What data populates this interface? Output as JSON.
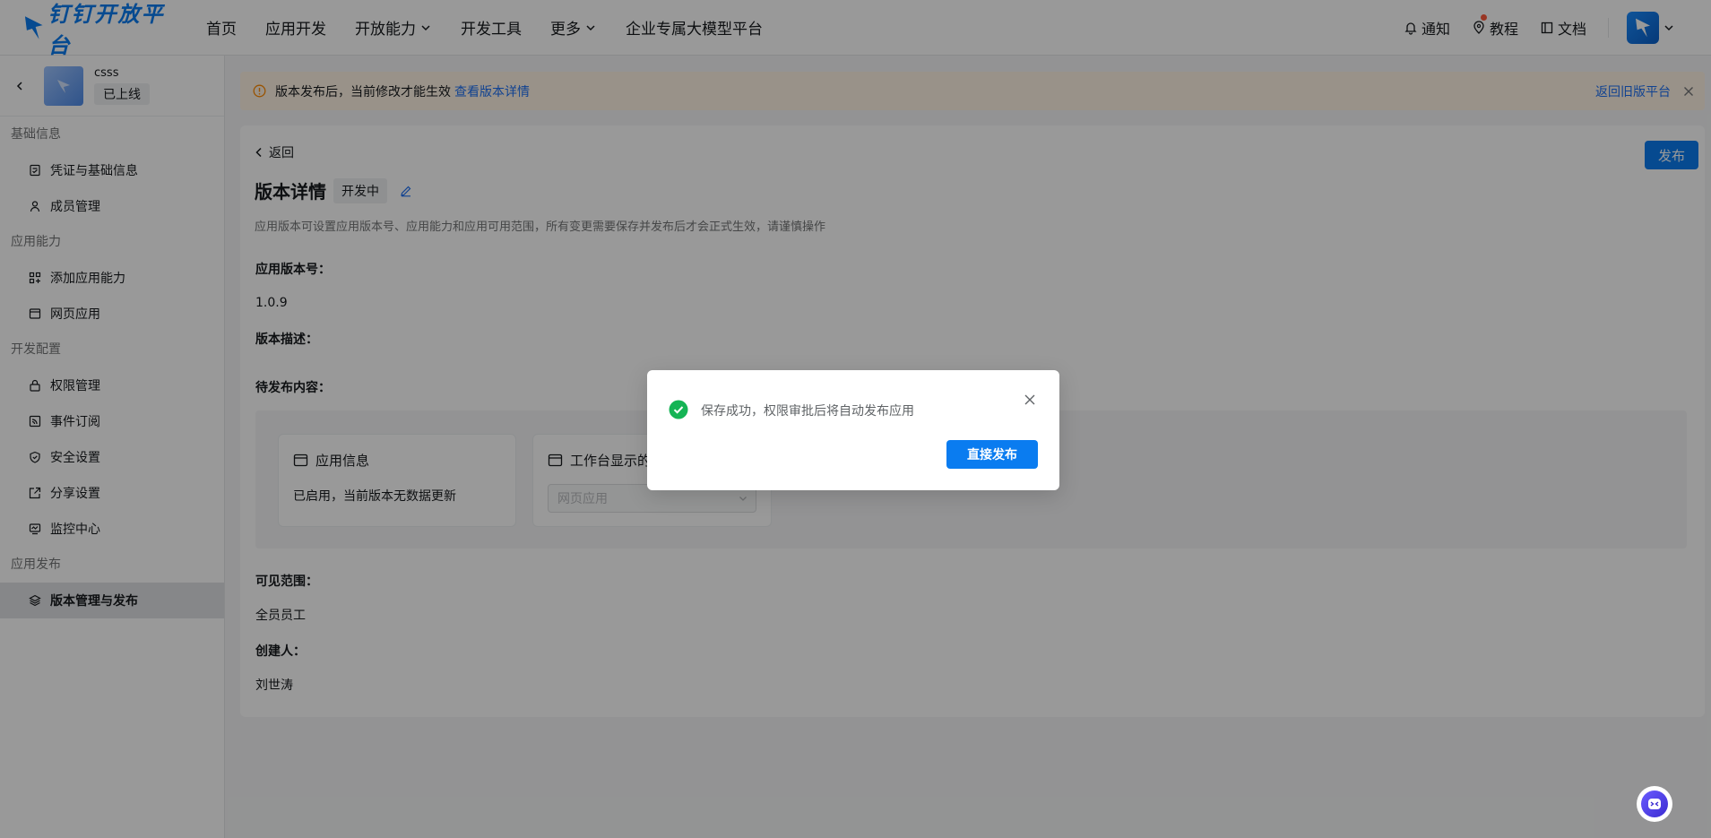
{
  "topnav": {
    "logo_text": "钉钉开放平台",
    "items": [
      {
        "label": "首页"
      },
      {
        "label": "应用开发"
      },
      {
        "label": "开放能力"
      },
      {
        "label": "开发工具"
      },
      {
        "label": "更多"
      },
      {
        "label": "企业专属大模型平台"
      }
    ],
    "notify_label": "通知",
    "tutorial_label": "教程",
    "docs_label": "文档"
  },
  "sidebar": {
    "app_name": "csss",
    "app_status": "已上线",
    "groups": [
      {
        "title": "基础信息",
        "items": [
          {
            "label": "凭证与基础信息"
          },
          {
            "label": "成员管理"
          }
        ]
      },
      {
        "title": "应用能力",
        "items": [
          {
            "label": "添加应用能力"
          },
          {
            "label": "网页应用"
          }
        ]
      },
      {
        "title": "开发配置",
        "items": [
          {
            "label": "权限管理"
          },
          {
            "label": "事件订阅"
          },
          {
            "label": "安全设置"
          },
          {
            "label": "分享设置"
          },
          {
            "label": "监控中心"
          }
        ]
      },
      {
        "title": "应用发布",
        "items": [
          {
            "label": "版本管理与发布"
          }
        ]
      }
    ]
  },
  "banner": {
    "text": "版本发布后，当前修改才能生效",
    "link": "查看版本详情",
    "old_platform": "返回旧版平台"
  },
  "main": {
    "back_label": "返回",
    "publish_label": "发布",
    "title": "版本详情",
    "status": "开发中",
    "description": "应用版本可设置应用版本号、应用能力和应用可用范围，所有变更需要保存并发布后才会正式生效，请谨慎操作",
    "version_label": "应用版本号：",
    "version_value": "1.0.9",
    "desc_label": "版本描述：",
    "pending_label": "待发布内容：",
    "app_info_title": "应用信息",
    "app_info_text": "已启用，当前版本无数据更新",
    "workbench_title": "工作台显示的",
    "workbench_select": "网页应用",
    "scope_label": "可见范围：",
    "scope_value": "全员员工",
    "creator_label": "创建人：",
    "creator_value": "刘世涛"
  },
  "modal": {
    "message": "保存成功，权限审批后将自动发布应用",
    "button": "直接发布"
  },
  "colors": {
    "primary": "#0a7cf0",
    "success": "#15b455",
    "banner_bg": "#fff4e5"
  }
}
